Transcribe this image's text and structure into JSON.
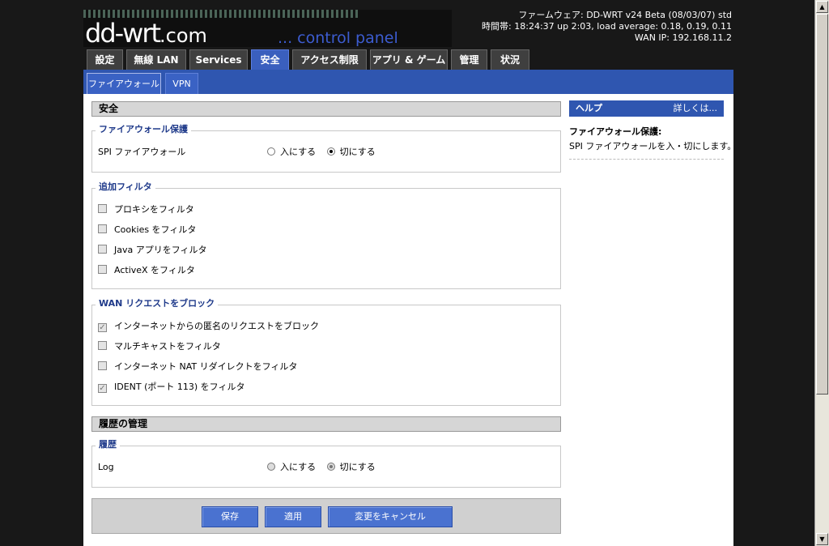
{
  "logo": {
    "main": "dd-wrt",
    "com": ".com",
    "sub": "... control panel"
  },
  "info": {
    "firmware": "ファームウェア: DD-WRT v24 Beta (08/03/07) std",
    "time": "時間帯: 18:24:37 up 2:03, load average: 0.18, 0.19, 0.11",
    "wanip": "WAN IP: 192.168.11.2"
  },
  "tabs": [
    "設定",
    "無線 LAN",
    "Services",
    "安全",
    "アクセス制限",
    "アプリ & ゲーム",
    "管理",
    "状況"
  ],
  "subtabs": [
    "ファイアウォール",
    "VPN"
  ],
  "security": {
    "title": "安全",
    "firewall": {
      "legend": "ファイアウォール保護",
      "spi_label": "SPI ファイアウォール",
      "enable": "入にする",
      "disable": "切にする"
    },
    "filters": {
      "legend": "追加フィルタ",
      "items": [
        "プロキシをフィルタ",
        "Cookies をフィルタ",
        "Java アプリをフィルタ",
        "ActiveX をフィルタ"
      ]
    },
    "wan_block": {
      "legend": "WAN リクエストをブロック",
      "items": [
        "インターネットからの匿名のリクエストをブロック",
        "マルチキャストをフィルタ",
        "インターネット NAT リダイレクトをフィルタ",
        "IDENT (ポート 113) をフィルタ"
      ]
    }
  },
  "log_mgmt": {
    "title": "履歴の管理",
    "legend": "履歴",
    "log_label": "Log",
    "enable": "入にする",
    "disable": "切にする"
  },
  "buttons": {
    "save": "保存",
    "apply": "適用",
    "cancel": "変更をキャンセル"
  },
  "help": {
    "title": "ヘルプ",
    "more": "詳しくは...",
    "topic": "ファイアウォール保護:",
    "text": "SPI ファイアウォールを入・切にします。"
  }
}
